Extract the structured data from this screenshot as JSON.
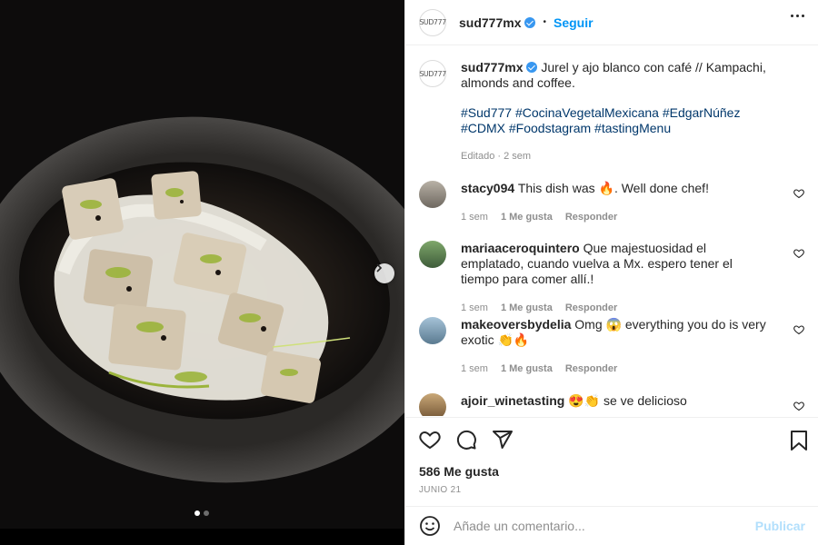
{
  "post": {
    "username": "sud777mx",
    "avatar_text": "SUD777",
    "follow_label": "Seguir",
    "separator": "•",
    "caption": "Jurel y ajo blanco con café // Kampachi, almonds and coffee.",
    "hashtags": "#Sud777 #CocinaVegetalMexicana #EdgarNúñez #CDMX #Foodstagram #tastingMenu",
    "edited": "Editado · 2 sem",
    "likes": "586 Me gusta",
    "date": "JUNIO 21"
  },
  "comments": [
    {
      "user": "stacy094",
      "text": "This dish was 🔥. Well done chef!",
      "time": "1 sem",
      "likes": "1 Me gusta",
      "reply": "Responder"
    },
    {
      "user": "mariaaceroquintero",
      "text": "Que majestuosidad el emplatado, cuando vuelva a Mx. espero tener el tiempo para comer allí.!",
      "time": "1 sem",
      "likes": "1 Me gusta",
      "reply": "Responder"
    },
    {
      "user": "makeoversbydelia",
      "text": "Omg 😱 everything you do is very exotic 👏🔥",
      "time": "1 sem",
      "likes": "1 Me gusta",
      "reply": "Responder"
    },
    {
      "user": "ajoir_winetasting",
      "text": "😍👏 se ve delicioso"
    }
  ],
  "comment_box": {
    "placeholder": "Añade un comentario...",
    "publish_label": "Publicar"
  },
  "icons": {
    "header": [
      "verified-icon",
      "more-options-icon"
    ],
    "actions": [
      "heart-icon",
      "comment-icon",
      "share-icon",
      "bookmark-icon"
    ],
    "carousel": [
      "chevron-right-icon"
    ],
    "comment_bar": [
      "emoji-icon"
    ]
  },
  "colors": {
    "link": "#0095f6",
    "hashtag": "#00376b",
    "muted": "#8e8e8e",
    "publish_disabled": "#b2dffc",
    "verified": "#3897f0"
  },
  "carousel": {
    "current": 1,
    "total": 2
  }
}
